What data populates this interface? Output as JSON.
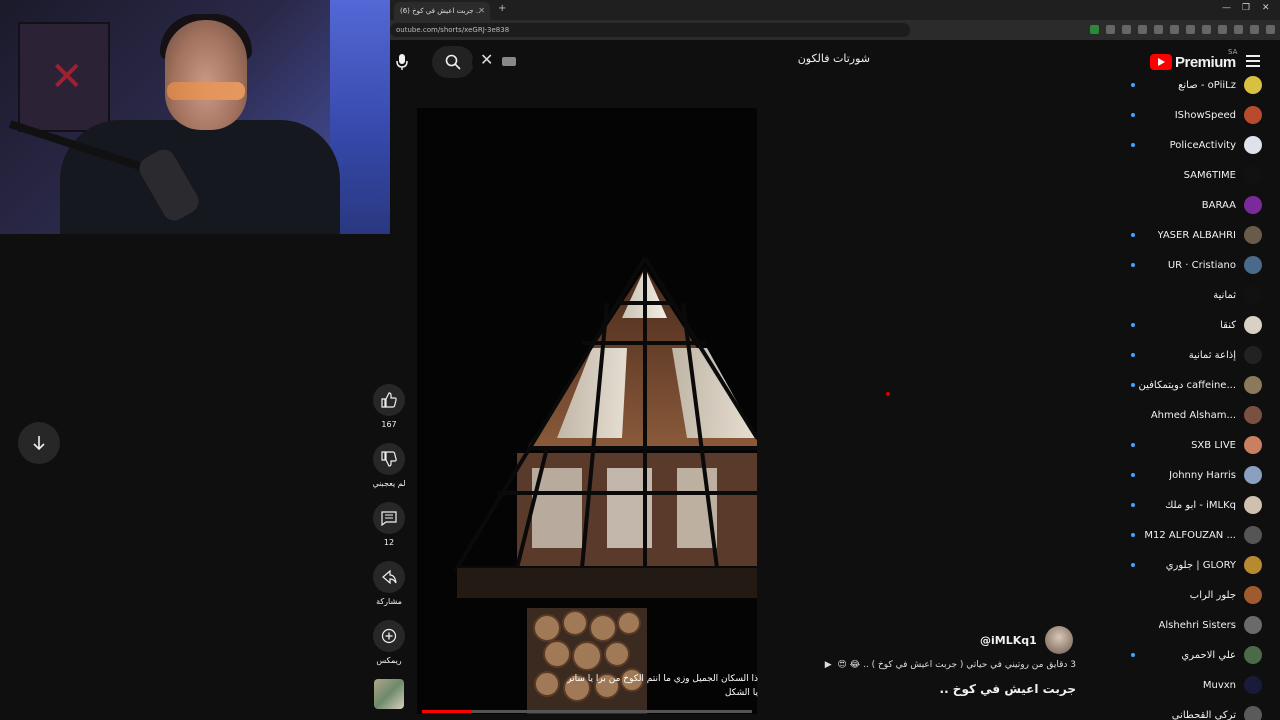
{
  "browser": {
    "tab_title": "(6) جربت اعيش في كوخ ..",
    "url": "outube.com/shorts/xeGRJ-3e838"
  },
  "masthead": {
    "logo_text": "Premium",
    "country": "SA",
    "search_value": "شورتات فالكون"
  },
  "player": {
    "progress_fraction": 0.15,
    "subtitle": "ذا السكان الجميل وزي ما انتم الكوخ من برا يا ساتر يا الشكل"
  },
  "actions": {
    "like_count": "167",
    "dislike_label": "لم يعجبني",
    "comment_count": "12",
    "share_label": "مشاركة",
    "remix_label": "ريمكس"
  },
  "metadata": {
    "channel": "@iMLKq1",
    "description": "3 دقايق من روتيني في حياتي ( جربت اعيش في كوخ ) .. 😂 😍",
    "title": "جربت اعيش في كوخ .."
  },
  "subscriptions": [
    {
      "name": "صانع - oPiiLz",
      "new": true,
      "color": "#d8c040"
    },
    {
      "name": "IShowSpeed",
      "new": true,
      "color": "#b84a2e"
    },
    {
      "name": "PoliceActivity",
      "new": true,
      "color": "#dfe2ea"
    },
    {
      "name": "SAM6TIME",
      "new": false,
      "color": "#111111"
    },
    {
      "name": "BARAA",
      "new": false,
      "color": "#7a2a9a"
    },
    {
      "name": "YASER ALBAHRI",
      "new": true,
      "color": "#6a5a4a"
    },
    {
      "name": "UR · Cristiano",
      "new": true,
      "color": "#4a6a8a"
    },
    {
      "name": "ثمانية",
      "new": false,
      "color": "#111111"
    },
    {
      "name": "كنقا",
      "new": true,
      "color": "#d9d2c4"
    },
    {
      "name": "إذاعة ثمانية",
      "new": true,
      "color": "#222222"
    },
    {
      "name": "دويتمكافين caffeine...",
      "new": true,
      "color": "#8a7a5a"
    },
    {
      "name": "Ahmed Alsham...",
      "new": false,
      "color": "#7a5040"
    },
    {
      "name": "SXB LIVE",
      "new": true,
      "color": "#c88060"
    },
    {
      "name": "Johnny Harris",
      "new": true,
      "color": "#8aa0c0"
    },
    {
      "name": "ابو ملك - iMLKq",
      "new": true,
      "color": "#d0c0b0"
    },
    {
      "name": "M12 ALFOUZAN ...",
      "new": true,
      "color": "#555555"
    },
    {
      "name": "جلوري | GLORY",
      "new": true,
      "color": "#b88a30"
    },
    {
      "name": "جلور الراب",
      "new": false,
      "color": "#a05a30"
    },
    {
      "name": "Alshehri Sisters",
      "new": false,
      "color": "#6a6a6a"
    },
    {
      "name": "علي الاحمري",
      "new": true,
      "color": "#4a6a4a"
    },
    {
      "name": "Muvxn",
      "new": false,
      "color": "#1a1a3a"
    },
    {
      "name": "تركي القحطاني",
      "new": false,
      "color": "#5a5a5a"
    }
  ]
}
